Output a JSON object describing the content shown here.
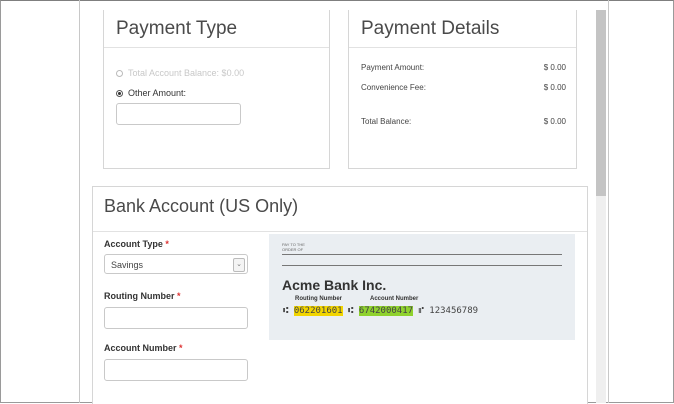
{
  "payment_type": {
    "title": "Payment Type",
    "options": [
      {
        "label": "Total Account Balance: $0.00",
        "checked": false,
        "disabled": true
      },
      {
        "label": "Other Amount:",
        "checked": true,
        "disabled": false
      }
    ],
    "other_amount_value": ""
  },
  "payment_details": {
    "title": "Payment Details",
    "rows": [
      {
        "label": "Payment Amount:",
        "value": "$ 0.00"
      },
      {
        "label": "Convenience Fee:",
        "value": "$ 0.00"
      },
      {
        "label": "Total Balance:",
        "value": "$ 0.00"
      }
    ]
  },
  "bank": {
    "title": "Bank Account (US Only)",
    "account_type_label": "Account Type",
    "account_type_value": "Savings",
    "routing_label": "Routing Number",
    "routing_value": "",
    "account_label": "Account Number",
    "account_value": "",
    "required_mark": "*"
  },
  "check": {
    "pay_to_line1": "PAY TO THE",
    "pay_to_line2": "ORDER OF",
    "bank_name": "Acme Bank Inc.",
    "routing_caption": "Routing Number",
    "account_caption": "Account Number",
    "routing_number": "062201601",
    "account_number": "6742000417",
    "check_number": "123456789",
    "micr_symbol_1": "⑆",
    "micr_symbol_2": "⑆",
    "micr_symbol_3": "⑈",
    "colors": {
      "routing_highlight": "#f2d500",
      "account_highlight": "#8fd22e"
    }
  }
}
